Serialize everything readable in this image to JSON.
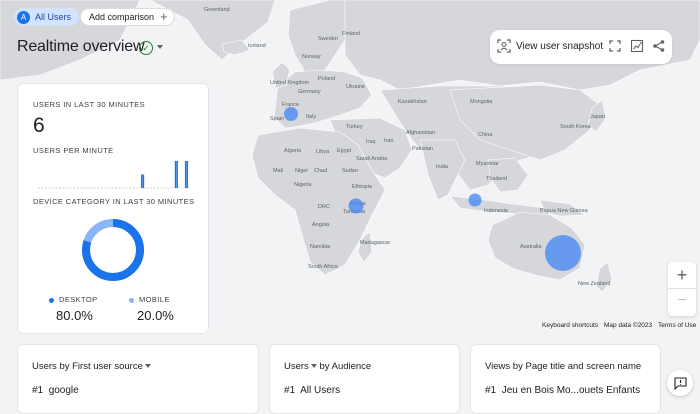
{
  "comparison": {
    "all_users_label": "All Users",
    "avatar_letter": "A",
    "add_comparison_label": "Add comparison"
  },
  "page": {
    "title": "Realtime overview"
  },
  "snapshot_bar": {
    "view_snapshot_label": "View user snapshot"
  },
  "summary_card": {
    "users_30min_label": "USERS IN LAST 30 MINUTES",
    "users_30min_value": "6",
    "users_per_minute_label": "USERS PER MINUTE",
    "users_per_minute_bars": [
      0,
      0,
      0,
      0,
      0,
      0,
      0,
      0,
      0,
      0,
      0,
      0,
      0,
      0,
      0,
      0,
      0,
      0,
      0,
      0,
      0,
      0,
      0,
      0,
      0,
      0,
      0,
      0,
      0,
      0,
      0,
      0,
      0,
      0,
      0,
      0,
      0,
      0,
      0,
      0,
      0,
      0,
      0,
      0,
      0,
      0,
      0,
      0,
      0,
      0,
      0,
      0,
      0,
      0,
      0,
      0,
      0,
      0,
      0,
      0,
      0,
      1,
      1,
      0,
      0,
      0,
      0,
      0,
      0,
      0,
      0,
      0,
      0,
      0,
      0,
      0,
      0,
      0,
      0,
      0,
      0,
      2,
      2,
      0,
      0,
      0,
      0,
      2,
      2,
      0
    ],
    "device_label": "DEVICE CATEGORY IN LAST 30 MINUTES",
    "legend": [
      {
        "name": "DESKTOP",
        "value": "80.0%",
        "color": "#1a73e8",
        "fraction": 0.8
      },
      {
        "name": "MOBILE",
        "value": "20.0%",
        "color": "#8ab4f8",
        "fraction": 0.2
      }
    ]
  },
  "map": {
    "labels": [
      "Greenland",
      "Iceland",
      "Sweden",
      "Finland",
      "Norway",
      "United Kingdom",
      "Poland",
      "Ukraine",
      "Germany",
      "France",
      "Spain",
      "Italy",
      "Kazakhstan",
      "Mongolia",
      "Turkey",
      "Iran",
      "Afghanistan",
      "Iraq",
      "Pakistan",
      "China",
      "India",
      "Saudi Arabia",
      "Algeria",
      "Libya",
      "Egypt",
      "Mali",
      "Niger",
      "Sudan",
      "Chad",
      "Nigeria",
      "Ethiopia",
      "DRC",
      "Kenya",
      "Tanzania",
      "Angola",
      "Namibia",
      "Madagascar",
      "South Africa",
      "Myanmar",
      "Thailand",
      "Japan",
      "South Korea",
      "Indonesia",
      "Papua New Guinea",
      "Australia",
      "New Zealand"
    ],
    "attribution": {
      "shortcuts": "Keyboard shortcuts",
      "mapdata": "Map data ©2023",
      "terms": "Terms of Use"
    },
    "zoom_in": "+",
    "zoom_out": "−",
    "bubble_color": "#4285f4"
  },
  "bottom_cards": [
    {
      "title": "Users by First user source",
      "row_rank": "#1",
      "row_value": "google"
    },
    {
      "title": "Users",
      "title_suffix": "by Audience",
      "row_rank": "#1",
      "row_value": "All Users"
    },
    {
      "title": "Views by Page title and screen name",
      "row_rank": "#1",
      "row_value": "Jeu en Bois Mo...ouets Enfants"
    }
  ]
}
